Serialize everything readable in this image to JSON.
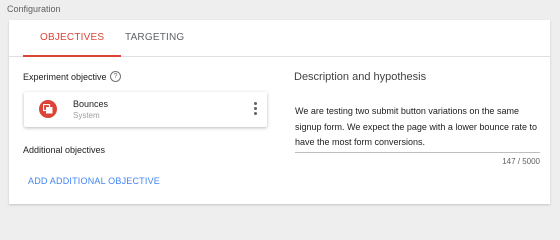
{
  "breadcrumb": "Configuration",
  "tabs": [
    {
      "label": "OBJECTIVES",
      "active": true
    },
    {
      "label": "TARGETING",
      "active": false
    }
  ],
  "experiment_objective": {
    "label": "Experiment objective",
    "help_icon": "help-circle-icon",
    "card": {
      "icon": "bounce-icon",
      "title": "Bounces",
      "subtitle": "System",
      "menu_icon": "more-vert-icon"
    }
  },
  "additional_objectives": {
    "label": "Additional objectives",
    "add_button": "ADD ADDITIONAL OBJECTIVE"
  },
  "description": {
    "title": "Description and hypothesis",
    "value": "We are testing two submit button variations on the same signup form. We expect the page with a lower bounce rate to have the most form conversions.",
    "counter": "147 / 5000"
  },
  "colors": {
    "accent_red": "#db4437",
    "link_blue": "#4285f4"
  }
}
